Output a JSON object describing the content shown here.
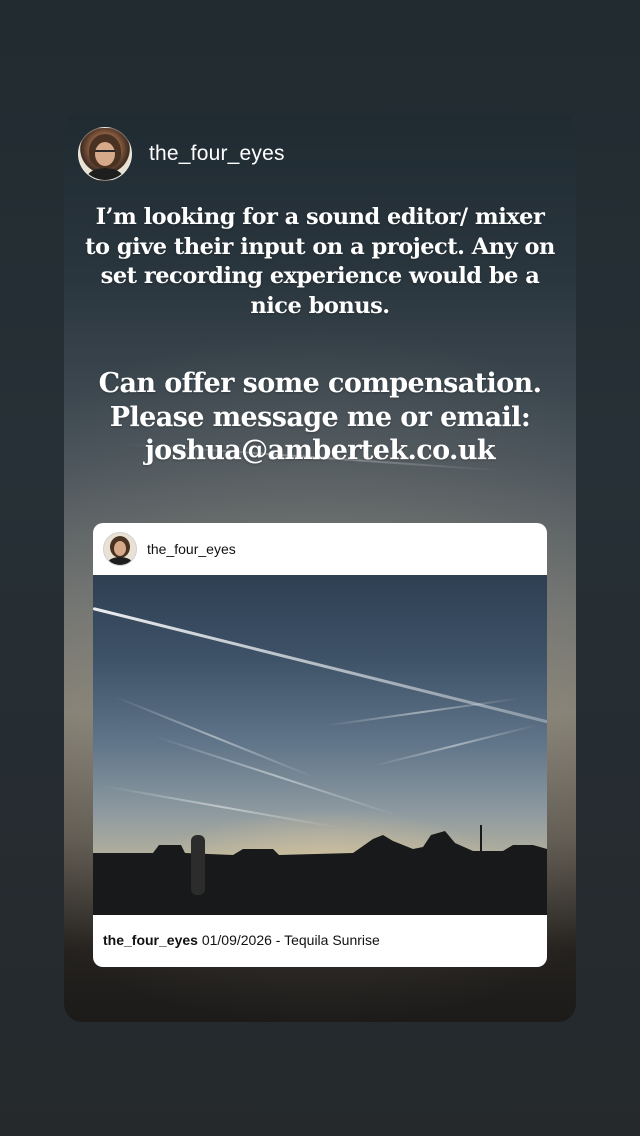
{
  "story": {
    "username": "the_four_eyes",
    "text_1": "I’m looking for a sound editor/ mixer to give their input on a project. Any on set recording experience would be a nice bonus.",
    "text_2": "Can offer some compensation. Please message me or email: joshua@ambertek.co.uk"
  },
  "shared_post": {
    "username": "the_four_eyes",
    "caption_username": "the_four_eyes",
    "caption_text": "01/09/2026 - Tequila Sunrise"
  }
}
